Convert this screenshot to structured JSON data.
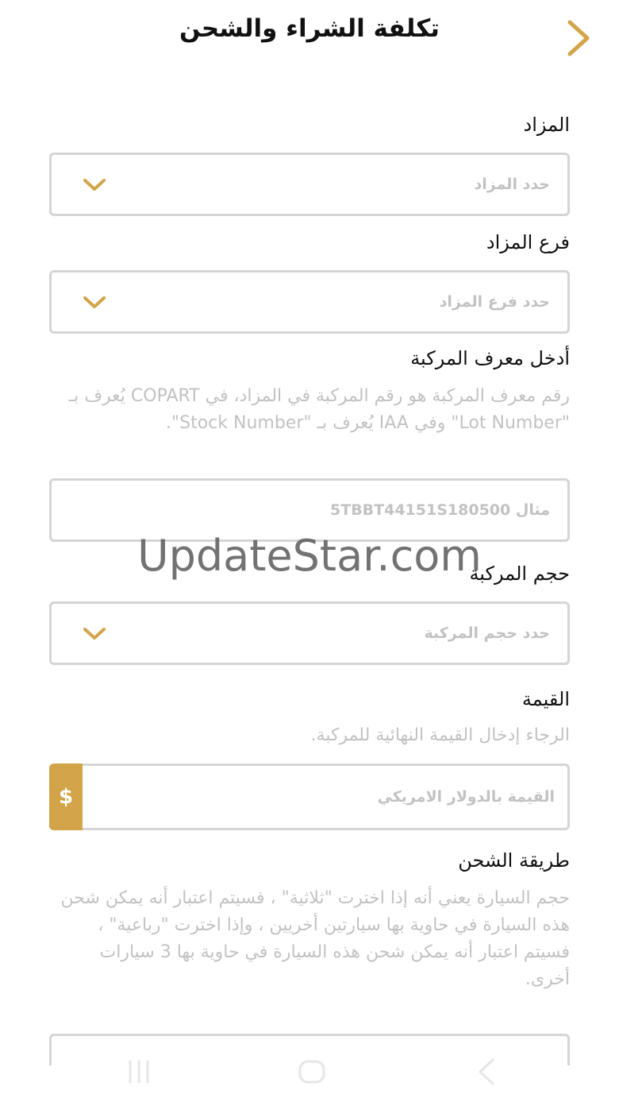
{
  "header": {
    "title": "تكلفة الشراء والشحن",
    "back_icon": "chevron-right-icon"
  },
  "colors": {
    "accent": "#d3a44a",
    "border": "#d5d5d5",
    "placeholder": "#c2c2c2"
  },
  "auction": {
    "label": "المزاد",
    "placeholder": "حدد المزاد"
  },
  "branch": {
    "label": "فرع المزاد",
    "placeholder": "حدد فرع المزاد"
  },
  "vehicle_id": {
    "label": "أدخل معرف المركبة",
    "help": "رقم معرف المركبة هو رقم المركبة في المزاد، في COPART يُعرف بـ \"Lot Number\" وفي IAA يُعرف بـ \"Stock Number\".",
    "placeholder": "مثال 5TBBT44151S180500"
  },
  "vehicle_size": {
    "label": "حجم المركبة",
    "placeholder": "حدد  حجم المركبة"
  },
  "value": {
    "label": "القيمة",
    "help": "الرجاء إدخال القيمة النهائية للمركبة.",
    "currency_symbol": "$",
    "placeholder": "القيمة بالدولار الامريكي"
  },
  "shipping": {
    "label": "طريقة الشحن",
    "help": "حجم السيارة يعني أنه إذا اخترت \"ثلاثية\" ، فسيتم اعتبار أنه يمكن شحن هذه السيارة في حاوية بها سيارتين أخريين ، وإذا اخترت \"رباعية\" ، فسيتم اعتبار أنه يمكن شحن هذه السيارة في حاوية بها 3 سيارات أخرى."
  },
  "watermark": "UpdateStar.com",
  "navbar": {
    "recents_icon": "recents-icon",
    "home_icon": "home-icon",
    "back_icon": "back-icon"
  }
}
